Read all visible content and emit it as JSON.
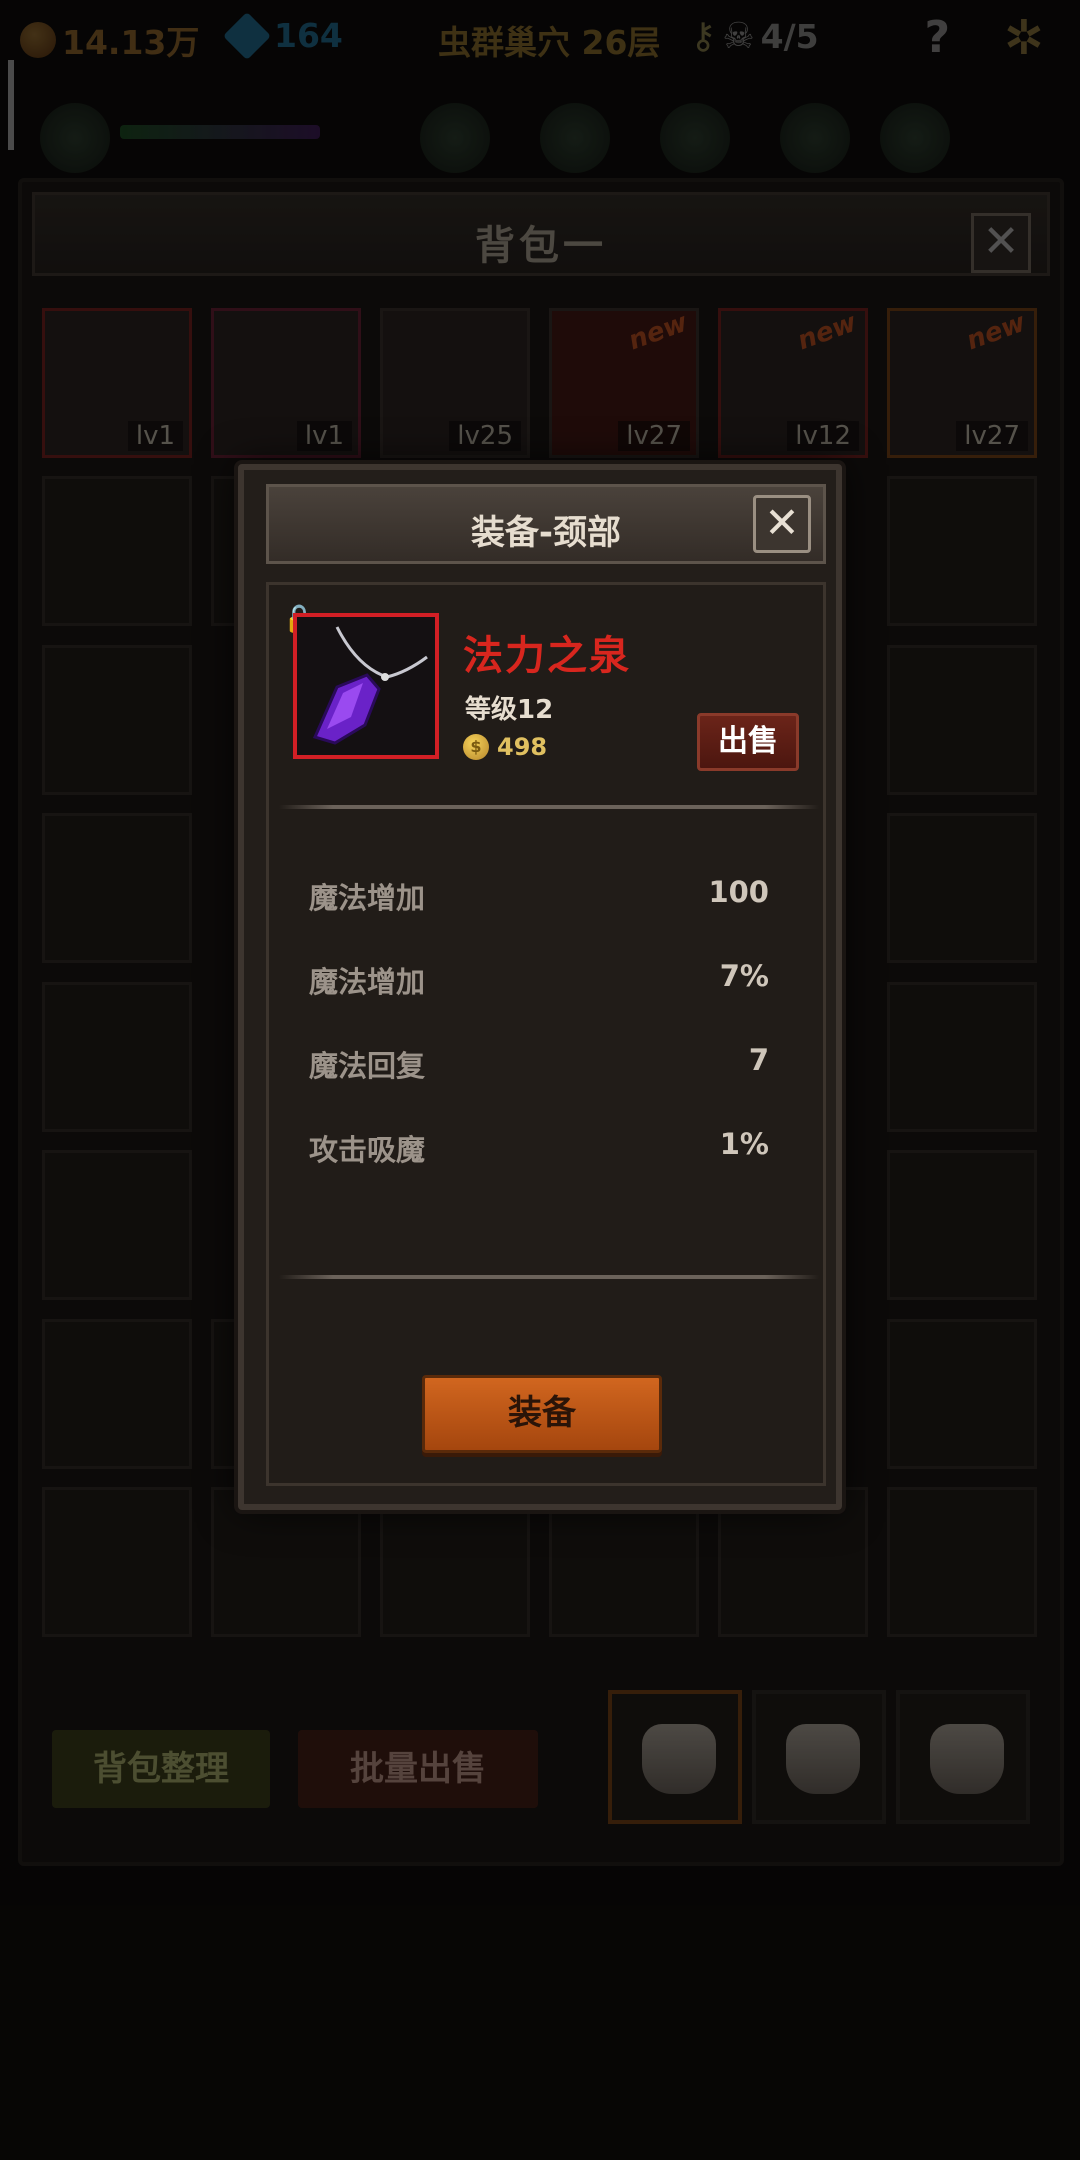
{
  "topbar": {
    "gold": "14.13万",
    "gems": "164",
    "stage": "虫群巢穴 26层",
    "keys_label": "",
    "skull_count": "4/5",
    "help": "?"
  },
  "bag": {
    "title": "背包一",
    "close": "✕",
    "items": [
      {
        "level": "lv1",
        "new": ""
      },
      {
        "level": "lv1",
        "new": ""
      },
      {
        "level": "lv25",
        "new": ""
      },
      {
        "level": "lv27",
        "new": "new"
      },
      {
        "level": "lv12",
        "new": "new"
      },
      {
        "level": "lv27",
        "new": "new"
      }
    ],
    "sort_button": "背包整理",
    "batch_sell_button": "批量出售"
  },
  "modal": {
    "title": "装备-颈部",
    "close": "✕",
    "item": {
      "name": "法力之泉",
      "level": "等级12",
      "price": "498",
      "price_icon": "coin-icon",
      "sell": "出售"
    },
    "attributes": [
      {
        "name": "魔法增加",
        "value": "100"
      },
      {
        "name": "魔法增加",
        "value": "7%"
      },
      {
        "name": "魔法回复",
        "value": "7"
      },
      {
        "name": "攻击吸魔",
        "value": "1%"
      }
    ],
    "equip_button": "装备"
  },
  "colors": {
    "item_name": "#d8261e",
    "rarity_frame": "#d21f25",
    "equip_button": "#c4571a"
  }
}
